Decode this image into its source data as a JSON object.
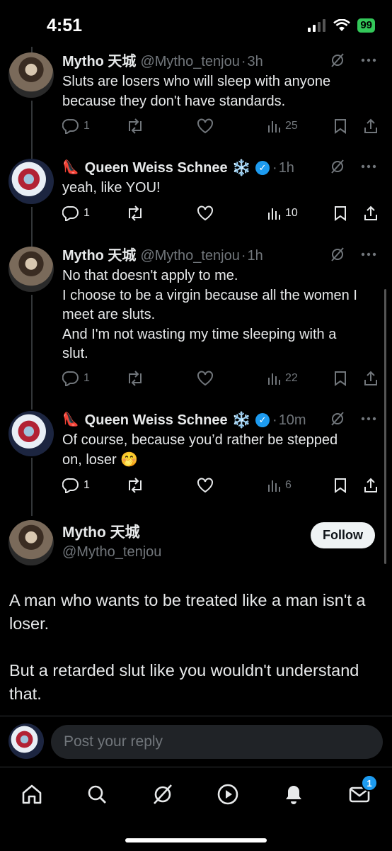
{
  "status_bar": {
    "time": "4:51",
    "battery": "99"
  },
  "tweets": [
    {
      "name": "Mytho 天城",
      "handle": "@Mytho_tenjou",
      "time": "3h",
      "lines": [
        "Sluts are losers who will sleep with anyone",
        "because they don't have standards."
      ],
      "replies": "1",
      "views": "25"
    },
    {
      "name": "Queen Weiss Schnee",
      "prefix_emoji": "👠",
      "suffix_emoji": "❄️",
      "handle": "",
      "time": "1h",
      "lines": [
        "yeah, like YOU!"
      ],
      "replies": "1",
      "views": "10"
    },
    {
      "name": "Mytho 天城",
      "handle": "@Mytho_tenjou",
      "time": "1h",
      "lines": [
        "No that doesn't apply to me.",
        "I choose to be a virgin because all the women I",
        "meet are sluts.",
        "And I'm not wasting my time sleeping with a",
        "slut."
      ],
      "replies": "1",
      "views": "22"
    },
    {
      "name": "Queen Weiss Schnee",
      "prefix_emoji": "👠",
      "suffix_emoji": "❄️",
      "handle": "",
      "time": "10m",
      "lines": [
        "Of course, because you’d rather be stepped",
        "on, loser 🤭"
      ],
      "replies": "1",
      "views": "6"
    }
  ],
  "main_tweet": {
    "name": "Mytho 天城",
    "handle": "@Mytho_tenjou",
    "follow_label": "Follow",
    "paragraphs": [
      "A man who wants to be treated like a man isn't a loser.",
      "But a retarded slut like you wouldn't understand that."
    ]
  },
  "reply": {
    "placeholder": "Post your reply"
  },
  "tabbar": {
    "messages_badge": "1"
  },
  "colors": {
    "accent": "#1d9bf0",
    "muted": "#71767b",
    "battery": "#33c759"
  }
}
